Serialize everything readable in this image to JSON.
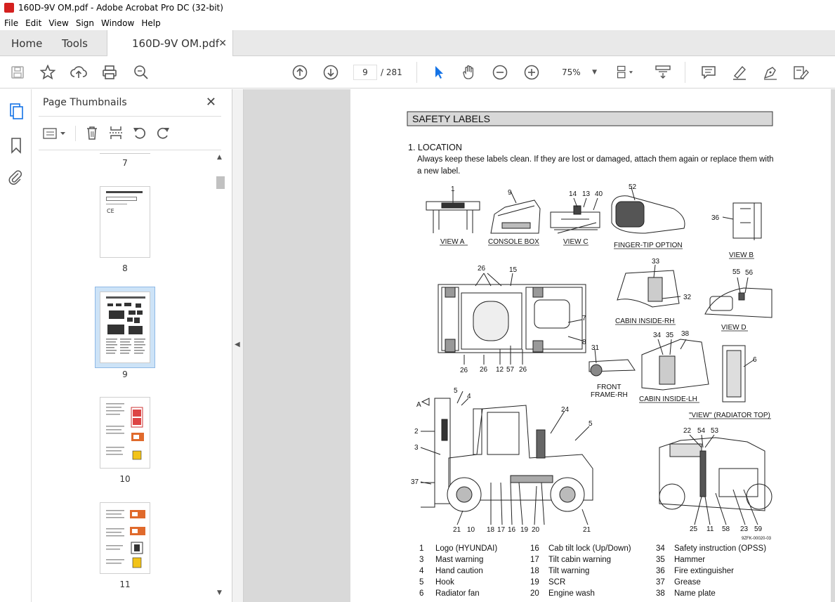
{
  "window": {
    "title": "160D-9V OM.pdf - Adobe Acrobat Pro DC (32-bit)"
  },
  "menu": [
    "File",
    "Edit",
    "View",
    "Sign",
    "Window",
    "Help"
  ],
  "tabs": {
    "home": "Home",
    "tools": "Tools",
    "document": "160D-9V OM.pdf"
  },
  "toolbar": {
    "current_page": "9",
    "total_pages": "/ 281",
    "zoom": "75%"
  },
  "panel": {
    "title": "Page Thumbnails",
    "thumbnails": [
      {
        "label": "7"
      },
      {
        "label": "8"
      },
      {
        "label": "9",
        "selected": true
      },
      {
        "label": "10"
      },
      {
        "label": "11"
      }
    ]
  },
  "document": {
    "section_title": "SAFETY LABELS",
    "heading": "1. LOCATION",
    "intro_line1": "Always keep these labels clean.  If they are lost or damaged, attach them again or replace them with",
    "intro_line2": "a new label.",
    "views": {
      "view_a": "VIEW  A",
      "console_box": "CONSOLE BOX",
      "view_c": "VIEW C",
      "finger_tip": "FINGER-TIP OPTION",
      "view_b": "VIEW B",
      "cabin_inside_rh": "CABIN INSIDE-RH",
      "view_d": "VIEW D",
      "front_frame_rh_1": "FRONT",
      "front_frame_rh_2": "FRAME-RH",
      "cabin_inside_lh": "CABIN INSIDE-LH",
      "radiator_top": "\"VIEW\" (RADIATOR TOP)",
      "arrow_a": "A",
      "drawing_code": "9ZFK-00020-03"
    },
    "callouts": {
      "c1": "1",
      "c9": "9",
      "c14": "14",
      "c13": "13",
      "c40": "40",
      "c52": "52",
      "c36": "36",
      "c26a": "26",
      "c15": "15",
      "c33": "33",
      "c32": "32",
      "c55": "55",
      "c56": "56",
      "c7": "7",
      "c8": "8",
      "c26b": "26",
      "c26c": "26",
      "c12": "12",
      "c57": "57",
      "c26d": "26",
      "c31": "31",
      "c34": "34",
      "c35": "35",
      "c38": "38",
      "c6": "6",
      "c5a": "5",
      "c4": "4",
      "c24": "24",
      "c5b": "5",
      "c2": "2",
      "c3": "3",
      "c37": "37",
      "c21a": "21",
      "c10": "10",
      "c18": "18",
      "c17": "17",
      "c16": "16",
      "c19": "19",
      "c20": "20",
      "c21b": "21",
      "c22": "22",
      "c54": "54",
      "c53": "53",
      "c25": "25",
      "c11": "11",
      "c58": "58",
      "c23": "23",
      "c59": "59"
    },
    "legend_col1": [
      {
        "no": "1",
        "name": "Logo (HYUNDAI)"
      },
      {
        "no": "3",
        "name": "Mast warning"
      },
      {
        "no": "4",
        "name": "Hand caution"
      },
      {
        "no": "5",
        "name": "Hook"
      },
      {
        "no": "6",
        "name": "Radiator fan"
      }
    ],
    "legend_col2": [
      {
        "no": "16",
        "name": "Cab tilt lock (Up/Down)"
      },
      {
        "no": "17",
        "name": "Tilt cabin warning"
      },
      {
        "no": "18",
        "name": "Tilt warning"
      },
      {
        "no": "19",
        "name": "SCR"
      },
      {
        "no": "20",
        "name": "Engine wash"
      }
    ],
    "legend_col3": [
      {
        "no": "34",
        "name": "Safety instruction (OPSS)"
      },
      {
        "no": "35",
        "name": "Hammer"
      },
      {
        "no": "36",
        "name": "Fire extinguisher"
      },
      {
        "no": "37",
        "name": "Grease"
      },
      {
        "no": "38",
        "name": "Name plate"
      }
    ]
  }
}
